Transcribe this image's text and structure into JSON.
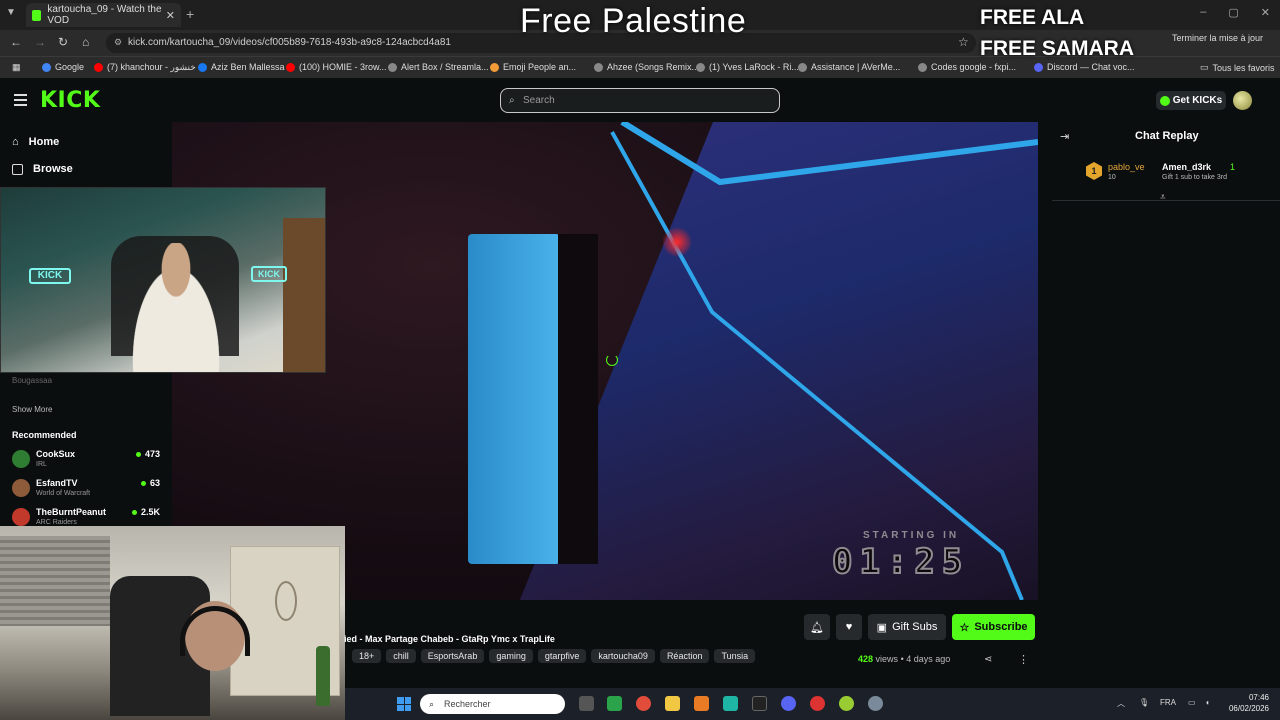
{
  "overlay": {
    "title": "Free Palestine",
    "free_ala": "FREE ALA",
    "free_samara": "FREE SAMARA"
  },
  "browser": {
    "tab_title": "kartoucha_09 - Watch the VOD",
    "url": "kick.com/kartoucha_09/videos/cf005b89-7618-493b-a9c8-124acbcd4a81",
    "update_label": "Terminer la mise à jour",
    "bookmarks": [
      {
        "label": "Google",
        "color": "#4285f4"
      },
      {
        "label": "(7) khanchour - خنشور",
        "color": "#ff0000"
      },
      {
        "label": "Aziz Ben Mallessa",
        "color": "#1877f2"
      },
      {
        "label": "(100) HOMIE - 3row...",
        "color": "#ff0000"
      },
      {
        "label": "Alert Box / Streamla...",
        "color": "#888888"
      },
      {
        "label": "Emoji People an...",
        "color": "#f29a38"
      },
      {
        "label": "Ahzee (Songs Remix...",
        "color": "#888888"
      },
      {
        "label": "(1) Yves LaRock - Ri...",
        "color": "#888888"
      },
      {
        "label": "Assistance | AVerMe...",
        "color": "#888888"
      },
      {
        "label": "Codes google - fxpi...",
        "color": "#888888"
      },
      {
        "label": "Discord — Chat voc...",
        "color": "#5865f2"
      }
    ],
    "all_favorites": "Tous les favoris"
  },
  "kick": {
    "logo": "KICK",
    "search_placeholder": "Search",
    "get_kicks": "Get KICKs"
  },
  "sidebar": {
    "home": "Home",
    "browse": "Browse",
    "faded_channel": "Bougassaa",
    "show_more": "Show More",
    "recommended_title": "Recommended",
    "recommended": [
      {
        "name": "CookSux",
        "category": "IRL",
        "viewers": "473",
        "color": "#2e7d32"
      },
      {
        "name": "EsfandTV",
        "category": "World of Warcraft",
        "viewers": "63",
        "color": "#8d5a3a"
      },
      {
        "name": "TheBurntPeanut",
        "category": "ARC Raiders",
        "viewers": "2.5K",
        "color": "#c0392b"
      }
    ]
  },
  "video": {
    "starting_label": "STARTING IN",
    "timer": "01:25"
  },
  "chat": {
    "title": "Chat Replay",
    "gift": {
      "badge": "1",
      "user": "pablo_ve",
      "count": "10",
      "recipient": "Amen_d3rk",
      "recipient_count": "1",
      "message": "Gift 1 sub to take 3rd"
    }
  },
  "stream": {
    "title": "ied - Max Partage Chabeb - GtaRp Ymc x TrapLife",
    "tags": [
      "18+",
      "chill",
      "EsportsArab",
      "gaming",
      "gtarpfive",
      "kartoucha09",
      "Réaction",
      "Tunsia"
    ],
    "gift_subs": "Gift Subs",
    "subscribe": "Subscribe",
    "views": "428",
    "views_suffix": "views",
    "ago": "4 days ago"
  },
  "taskbar": {
    "search_placeholder": "Rechercher",
    "lang": "FRA",
    "time": "07:46",
    "date": "06/02/2026"
  }
}
